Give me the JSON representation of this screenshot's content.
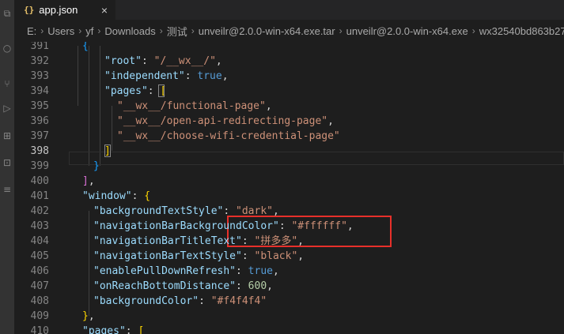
{
  "tab": {
    "icon": "{}",
    "title": "app.json",
    "close": "×"
  },
  "breadcrumb": [
    "E:",
    "Users",
    "yf",
    "Downloads",
    "测试",
    "unveilr@2.0.0-win-x64.exe.tar",
    "unveilr@2.0.0-win-x64.exe",
    "wx32540bd863b27"
  ],
  "breadcrumb_separator": "›",
  "activity_icons": [
    "files-icon",
    "search-icon",
    "source-control-icon",
    "run-debug-icon",
    "extensions-icon",
    "remote-icon",
    "accounts-icon"
  ],
  "activity_glyphs": [
    "⧉",
    "○",
    "⑂",
    "▷",
    "⊞",
    "⊡",
    "≡"
  ],
  "lines": [
    {
      "num": "391",
      "code": "{"
    },
    {
      "num": "392",
      "code": "\"root\": \"/__wx__/\","
    },
    {
      "num": "393",
      "code": "\"independent\": true,"
    },
    {
      "num": "394",
      "code": "\"pages\": ["
    },
    {
      "num": "395",
      "code": "\"__wx__/functional-page\","
    },
    {
      "num": "396",
      "code": "\"__wx__/open-api-redirecting-page\","
    },
    {
      "num": "397",
      "code": "\"__wx__/choose-wifi-credential-page\""
    },
    {
      "num": "398",
      "code": "]"
    },
    {
      "num": "399",
      "code": "}"
    },
    {
      "num": "400",
      "code": "],"
    },
    {
      "num": "401",
      "code": "\"window\": {"
    },
    {
      "num": "402",
      "code": "\"backgroundTextStyle\": \"dark\","
    },
    {
      "num": "403",
      "code": "\"navigationBarBackgroundColor\": \"#ffffff\","
    },
    {
      "num": "404",
      "code": "\"navigationBarTitleText\": \"拼多多\","
    },
    {
      "num": "405",
      "code": "\"navigationBarTextStyle\": \"black\","
    },
    {
      "num": "406",
      "code": "\"enablePullDownRefresh\": true,"
    },
    {
      "num": "407",
      "code": "\"onReachBottomDistance\": 600,"
    },
    {
      "num": "408",
      "code": "\"backgroundColor\": \"#f4f4f4\""
    },
    {
      "num": "409",
      "code": "},"
    },
    {
      "num": "410",
      "code": "\"pages\": ["
    }
  ],
  "active_line": "398",
  "colors": {
    "key": "#9cdcfe",
    "string": "#ce9178",
    "boolean": "#569cd6",
    "number": "#b5cea8",
    "highlight_box": "#e8302a"
  }
}
